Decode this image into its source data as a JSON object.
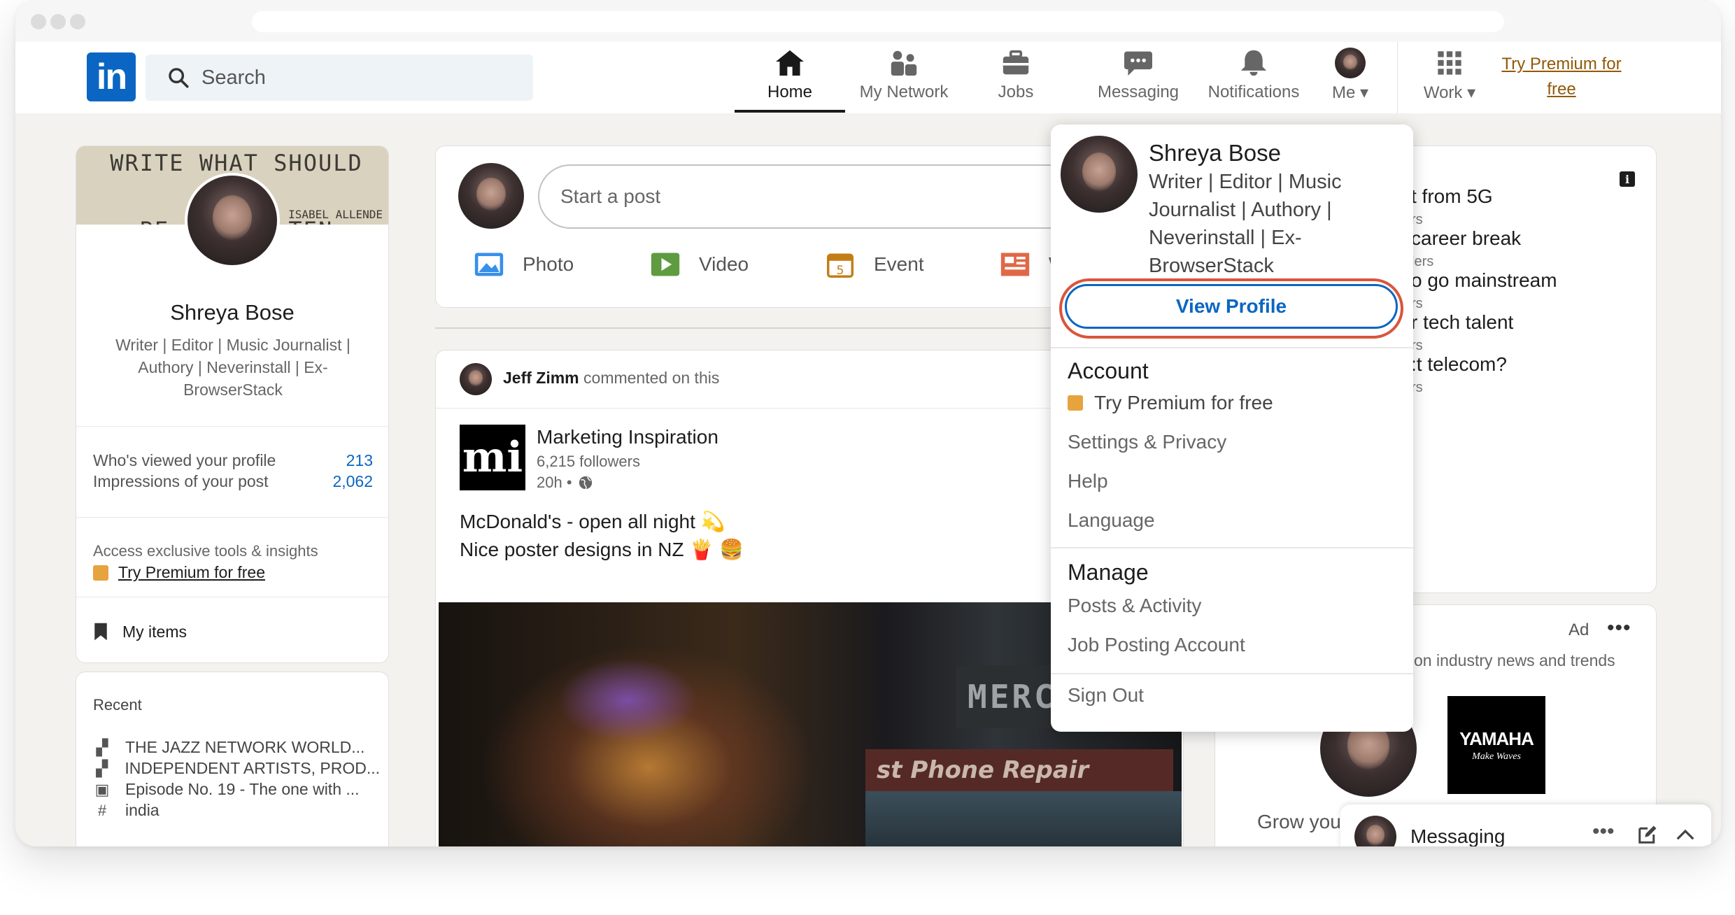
{
  "nav": {
    "search_placeholder": "Search",
    "items": [
      {
        "label": "Home"
      },
      {
        "label": "My Network"
      },
      {
        "label": "Jobs"
      },
      {
        "label": "Messaging"
      },
      {
        "label": "Notifications"
      },
      {
        "label": "Me"
      },
      {
        "label": "Work"
      }
    ],
    "premium_line1": "Try Premium for",
    "premium_line2": "free"
  },
  "profile": {
    "cover_line1": "WRITE WHAT SHOULD NOT",
    "cover_line2": "BE F      TEN",
    "cover_credit": "ISABEL ALLENDE",
    "name": "Shreya Bose",
    "headline": "Writer | Editor | Music Journalist | Authory | Neverinstall | Ex-BrowserStack",
    "stats": [
      {
        "label": "Who's viewed your profile",
        "value": "213"
      },
      {
        "label": "Impressions of your post",
        "value": "2,062"
      }
    ],
    "access_text": "Access exclusive tools & insights",
    "premium_text": "Try Premium for free",
    "my_items": "My items"
  },
  "recent": {
    "title": "Recent",
    "items": [
      {
        "label": "THE JAZZ NETWORK WORLD...",
        "icon": "group-icon"
      },
      {
        "label": "INDEPENDENT ARTISTS, PROD...",
        "icon": "group-icon"
      },
      {
        "label": "Episode No. 19 - The one with ...",
        "icon": "calendar-icon"
      },
      {
        "label": "india",
        "icon": "hashtag-icon"
      }
    ]
  },
  "share": {
    "start_post": "Start a post",
    "photo": "Photo",
    "video": "Video",
    "event": "Event",
    "article": "W"
  },
  "post": {
    "actor": "Jeff Zimm",
    "action": "commented on this",
    "page_name": "Marketing Inspiration",
    "followers": "6,215 followers",
    "time": "20h •",
    "line1": "McDonald's - open all night 💫",
    "line2": "Nice poster designs in NZ 🍟 🍔",
    "image_sign": "MERCH",
    "image_shop": "st Phone Repair"
  },
  "news": {
    "items": [
      {
        "title": "t from 5G",
        "sub": "rs"
      },
      {
        "title": "career break",
        "sub": "lers"
      },
      {
        "title": "o go mainstream",
        "sub": "rs"
      },
      {
        "title": "r tech talent",
        "sub": "rs"
      },
      {
        "title": ":t telecom?",
        "sub": "rs"
      }
    ]
  },
  "ad": {
    "label": "Ad",
    "dots": "•••",
    "text": "on industry news and trends",
    "brand": "YAMAHA",
    "tagline": "Make Waves",
    "grow": "Grow you"
  },
  "messaging": {
    "label": "Messaging",
    "dots": "•••"
  },
  "me_menu": {
    "name": "Shreya Bose",
    "headline_lines": [
      "Writer | Editor | Music",
      "Journalist | Authory |",
      "Neverinstall | Ex-",
      "BrowserStack"
    ],
    "view_profile": "View Profile",
    "account_header": "Account",
    "account_items": [
      "Try Premium for free",
      "Settings & Privacy",
      "Help",
      "Language"
    ],
    "manage_header": "Manage",
    "manage_items": [
      "Posts & Activity",
      "Job Posting Account"
    ],
    "sign_out": "Sign Out"
  },
  "colors": {
    "brand": "#0a66c2",
    "premium": "#915907",
    "premium_badge": "#e7a33e",
    "highlight_ring": "#d9553b",
    "background": "#f3f2ef"
  }
}
